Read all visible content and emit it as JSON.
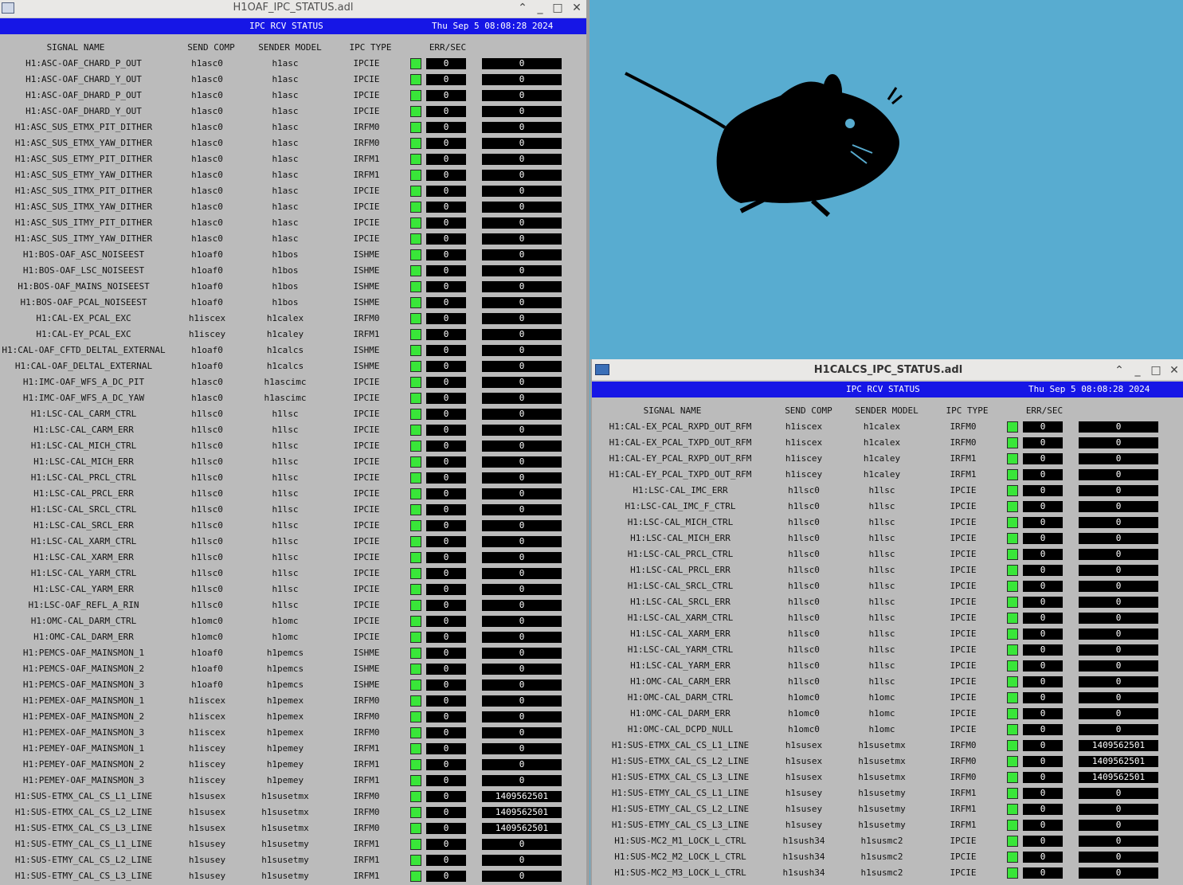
{
  "desktop": {
    "background_color": "#58acd0",
    "logo": "xfce-mouse-logo"
  },
  "windows": [
    {
      "id": "win1",
      "title": "H1OAF_IPC_STATUS.adl",
      "banner_title": "IPC RCV STATUS",
      "timestamp": "Thu Sep  5 08:08:28 2024",
      "headers": {
        "signal": "SIGNAL NAME",
        "comp": "SEND COMP",
        "model": "SENDER MODEL",
        "type": "IPC TYPE",
        "err": "ERR/SEC"
      },
      "rows": [
        [
          "H1:ASC-OAF_CHARD_P_OUT",
          "h1asc0",
          "h1asc",
          "IPCIE",
          "0",
          "0"
        ],
        [
          "H1:ASC-OAF_CHARD_Y_OUT",
          "h1asc0",
          "h1asc",
          "IPCIE",
          "0",
          "0"
        ],
        [
          "H1:ASC-OAF_DHARD_P_OUT",
          "h1asc0",
          "h1asc",
          "IPCIE",
          "0",
          "0"
        ],
        [
          "H1:ASC-OAF_DHARD_Y_OUT",
          "h1asc0",
          "h1asc",
          "IPCIE",
          "0",
          "0"
        ],
        [
          "H1:ASC_SUS_ETMX_PIT_DITHER",
          "h1asc0",
          "h1asc",
          "IRFM0",
          "0",
          "0"
        ],
        [
          "H1:ASC_SUS_ETMX_YAW_DITHER",
          "h1asc0",
          "h1asc",
          "IRFM0",
          "0",
          "0"
        ],
        [
          "H1:ASC_SUS_ETMY_PIT_DITHER",
          "h1asc0",
          "h1asc",
          "IRFM1",
          "0",
          "0"
        ],
        [
          "H1:ASC_SUS_ETMY_YAW_DITHER",
          "h1asc0",
          "h1asc",
          "IRFM1",
          "0",
          "0"
        ],
        [
          "H1:ASC_SUS_ITMX_PIT_DITHER",
          "h1asc0",
          "h1asc",
          "IPCIE",
          "0",
          "0"
        ],
        [
          "H1:ASC_SUS_ITMX_YAW_DITHER",
          "h1asc0",
          "h1asc",
          "IPCIE",
          "0",
          "0"
        ],
        [
          "H1:ASC_SUS_ITMY_PIT_DITHER",
          "h1asc0",
          "h1asc",
          "IPCIE",
          "0",
          "0"
        ],
        [
          "H1:ASC_SUS_ITMY_YAW_DITHER",
          "h1asc0",
          "h1asc",
          "IPCIE",
          "0",
          "0"
        ],
        [
          "H1:BOS-OAF_ASC_NOISEEST",
          "h1oaf0",
          "h1bos",
          "ISHME",
          "0",
          "0"
        ],
        [
          "H1:BOS-OAF_LSC_NOISEEST",
          "h1oaf0",
          "h1bos",
          "ISHME",
          "0",
          "0"
        ],
        [
          "H1:BOS-OAF_MAINS_NOISEEST",
          "h1oaf0",
          "h1bos",
          "ISHME",
          "0",
          "0"
        ],
        [
          "H1:BOS-OAF_PCAL_NOISEEST",
          "h1oaf0",
          "h1bos",
          "ISHME",
          "0",
          "0"
        ],
        [
          "H1:CAL-EX_PCAL_EXC",
          "h1iscex",
          "h1calex",
          "IRFM0",
          "0",
          "0"
        ],
        [
          "H1:CAL-EY_PCAL_EXC",
          "h1iscey",
          "h1caley",
          "IRFM1",
          "0",
          "0"
        ],
        [
          "H1:CAL-OAF_CFTD_DELTAL_EXTERNAL",
          "h1oaf0",
          "h1calcs",
          "ISHME",
          "0",
          "0"
        ],
        [
          "H1:CAL-OAF_DELTAL_EXTERNAL",
          "h1oaf0",
          "h1calcs",
          "ISHME",
          "0",
          "0"
        ],
        [
          "H1:IMC-OAF_WFS_A_DC_PIT",
          "h1asc0",
          "h1ascimc",
          "IPCIE",
          "0",
          "0"
        ],
        [
          "H1:IMC-OAF_WFS_A_DC_YAW",
          "h1asc0",
          "h1ascimc",
          "IPCIE",
          "0",
          "0"
        ],
        [
          "H1:LSC-CAL_CARM_CTRL",
          "h1lsc0",
          "h1lsc",
          "IPCIE",
          "0",
          "0"
        ],
        [
          "H1:LSC-CAL_CARM_ERR",
          "h1lsc0",
          "h1lsc",
          "IPCIE",
          "0",
          "0"
        ],
        [
          "H1:LSC-CAL_MICH_CTRL",
          "h1lsc0",
          "h1lsc",
          "IPCIE",
          "0",
          "0"
        ],
        [
          "H1:LSC-CAL_MICH_ERR",
          "h1lsc0",
          "h1lsc",
          "IPCIE",
          "0",
          "0"
        ],
        [
          "H1:LSC-CAL_PRCL_CTRL",
          "h1lsc0",
          "h1lsc",
          "IPCIE",
          "0",
          "0"
        ],
        [
          "H1:LSC-CAL_PRCL_ERR",
          "h1lsc0",
          "h1lsc",
          "IPCIE",
          "0",
          "0"
        ],
        [
          "H1:LSC-CAL_SRCL_CTRL",
          "h1lsc0",
          "h1lsc",
          "IPCIE",
          "0",
          "0"
        ],
        [
          "H1:LSC-CAL_SRCL_ERR",
          "h1lsc0",
          "h1lsc",
          "IPCIE",
          "0",
          "0"
        ],
        [
          "H1:LSC-CAL_XARM_CTRL",
          "h1lsc0",
          "h1lsc",
          "IPCIE",
          "0",
          "0"
        ],
        [
          "H1:LSC-CAL_XARM_ERR",
          "h1lsc0",
          "h1lsc",
          "IPCIE",
          "0",
          "0"
        ],
        [
          "H1:LSC-CAL_YARM_CTRL",
          "h1lsc0",
          "h1lsc",
          "IPCIE",
          "0",
          "0"
        ],
        [
          "H1:LSC-CAL_YARM_ERR",
          "h1lsc0",
          "h1lsc",
          "IPCIE",
          "0",
          "0"
        ],
        [
          "H1:LSC-OAF_REFL_A_RIN",
          "h1lsc0",
          "h1lsc",
          "IPCIE",
          "0",
          "0"
        ],
        [
          "H1:OMC-CAL_DARM_CTRL",
          "h1omc0",
          "h1omc",
          "IPCIE",
          "0",
          "0"
        ],
        [
          "H1:OMC-CAL_DARM_ERR",
          "h1omc0",
          "h1omc",
          "IPCIE",
          "0",
          "0"
        ],
        [
          "H1:PEMCS-OAF_MAINSMON_1",
          "h1oaf0",
          "h1pemcs",
          "ISHME",
          "0",
          "0"
        ],
        [
          "H1:PEMCS-OAF_MAINSMON_2",
          "h1oaf0",
          "h1pemcs",
          "ISHME",
          "0",
          "0"
        ],
        [
          "H1:PEMCS-OAF_MAINSMON_3",
          "h1oaf0",
          "h1pemcs",
          "ISHME",
          "0",
          "0"
        ],
        [
          "H1:PEMEX-OAF_MAINSMON_1",
          "h1iscex",
          "h1pemex",
          "IRFM0",
          "0",
          "0"
        ],
        [
          "H1:PEMEX-OAF_MAINSMON_2",
          "h1iscex",
          "h1pemex",
          "IRFM0",
          "0",
          "0"
        ],
        [
          "H1:PEMEX-OAF_MAINSMON_3",
          "h1iscex",
          "h1pemex",
          "IRFM0",
          "0",
          "0"
        ],
        [
          "H1:PEMEY-OAF_MAINSMON_1",
          "h1iscey",
          "h1pemey",
          "IRFM1",
          "0",
          "0"
        ],
        [
          "H1:PEMEY-OAF_MAINSMON_2",
          "h1iscey",
          "h1pemey",
          "IRFM1",
          "0",
          "0"
        ],
        [
          "H1:PEMEY-OAF_MAINSMON_3",
          "h1iscey",
          "h1pemey",
          "IRFM1",
          "0",
          "0"
        ],
        [
          "H1:SUS-ETMX_CAL_CS_L1_LINE",
          "h1susex",
          "h1susetmx",
          "IRFM0",
          "0",
          "1409562501"
        ],
        [
          "H1:SUS-ETMX_CAL_CS_L2_LINE",
          "h1susex",
          "h1susetmx",
          "IRFM0",
          "0",
          "1409562501"
        ],
        [
          "H1:SUS-ETMX_CAL_CS_L3_LINE",
          "h1susex",
          "h1susetmx",
          "IRFM0",
          "0",
          "1409562501"
        ],
        [
          "H1:SUS-ETMY_CAL_CS_L1_LINE",
          "h1susey",
          "h1susetmy",
          "IRFM1",
          "0",
          "0"
        ],
        [
          "H1:SUS-ETMY_CAL_CS_L2_LINE",
          "h1susey",
          "h1susetmy",
          "IRFM1",
          "0",
          "0"
        ],
        [
          "H1:SUS-ETMY_CAL_CS_L3_LINE",
          "h1susey",
          "h1susetmy",
          "IRFM1",
          "0",
          "0"
        ]
      ]
    },
    {
      "id": "win2",
      "title": "H1CALCS_IPC_STATUS.adl",
      "banner_title": "IPC RCV STATUS",
      "timestamp": "Thu Sep  5 08:08:28 2024",
      "headers": {
        "signal": "SIGNAL NAME",
        "comp": "SEND COMP",
        "model": "SENDER MODEL",
        "type": "IPC TYPE",
        "err": "ERR/SEC"
      },
      "rows": [
        [
          "H1:CAL-EX_PCAL_RXPD_OUT_RFM",
          "h1iscex",
          "h1calex",
          "IRFM0",
          "0",
          "0"
        ],
        [
          "H1:CAL-EX_PCAL_TXPD_OUT_RFM",
          "h1iscex",
          "h1calex",
          "IRFM0",
          "0",
          "0"
        ],
        [
          "H1:CAL-EY_PCAL_RXPD_OUT_RFM",
          "h1iscey",
          "h1caley",
          "IRFM1",
          "0",
          "0"
        ],
        [
          "H1:CAL-EY_PCAL_TXPD_OUT_RFM",
          "h1iscey",
          "h1caley",
          "IRFM1",
          "0",
          "0"
        ],
        [
          "H1:LSC-CAL_IMC_ERR",
          "h1lsc0",
          "h1lsc",
          "IPCIE",
          "0",
          "0"
        ],
        [
          "H1:LSC-CAL_IMC_F_CTRL",
          "h1lsc0",
          "h1lsc",
          "IPCIE",
          "0",
          "0"
        ],
        [
          "H1:LSC-CAL_MICH_CTRL",
          "h1lsc0",
          "h1lsc",
          "IPCIE",
          "0",
          "0"
        ],
        [
          "H1:LSC-CAL_MICH_ERR",
          "h1lsc0",
          "h1lsc",
          "IPCIE",
          "0",
          "0"
        ],
        [
          "H1:LSC-CAL_PRCL_CTRL",
          "h1lsc0",
          "h1lsc",
          "IPCIE",
          "0",
          "0"
        ],
        [
          "H1:LSC-CAL_PRCL_ERR",
          "h1lsc0",
          "h1lsc",
          "IPCIE",
          "0",
          "0"
        ],
        [
          "H1:LSC-CAL_SRCL_CTRL",
          "h1lsc0",
          "h1lsc",
          "IPCIE",
          "0",
          "0"
        ],
        [
          "H1:LSC-CAL_SRCL_ERR",
          "h1lsc0",
          "h1lsc",
          "IPCIE",
          "0",
          "0"
        ],
        [
          "H1:LSC-CAL_XARM_CTRL",
          "h1lsc0",
          "h1lsc",
          "IPCIE",
          "0",
          "0"
        ],
        [
          "H1:LSC-CAL_XARM_ERR",
          "h1lsc0",
          "h1lsc",
          "IPCIE",
          "0",
          "0"
        ],
        [
          "H1:LSC-CAL_YARM_CTRL",
          "h1lsc0",
          "h1lsc",
          "IPCIE",
          "0",
          "0"
        ],
        [
          "H1:LSC-CAL_YARM_ERR",
          "h1lsc0",
          "h1lsc",
          "IPCIE",
          "0",
          "0"
        ],
        [
          "H1:OMC-CAL_CARM_ERR",
          "h1lsc0",
          "h1lsc",
          "IPCIE",
          "0",
          "0"
        ],
        [
          "H1:OMC-CAL_DARM_CTRL",
          "h1omc0",
          "h1omc",
          "IPCIE",
          "0",
          "0"
        ],
        [
          "H1:OMC-CAL_DARM_ERR",
          "h1omc0",
          "h1omc",
          "IPCIE",
          "0",
          "0"
        ],
        [
          "H1:OMC-CAL_DCPD_NULL",
          "h1omc0",
          "h1omc",
          "IPCIE",
          "0",
          "0"
        ],
        [
          "H1:SUS-ETMX_CAL_CS_L1_LINE",
          "h1susex",
          "h1susetmx",
          "IRFM0",
          "0",
          "1409562501"
        ],
        [
          "H1:SUS-ETMX_CAL_CS_L2_LINE",
          "h1susex",
          "h1susetmx",
          "IRFM0",
          "0",
          "1409562501"
        ],
        [
          "H1:SUS-ETMX_CAL_CS_L3_LINE",
          "h1susex",
          "h1susetmx",
          "IRFM0",
          "0",
          "1409562501"
        ],
        [
          "H1:SUS-ETMY_CAL_CS_L1_LINE",
          "h1susey",
          "h1susetmy",
          "IRFM1",
          "0",
          "0"
        ],
        [
          "H1:SUS-ETMY_CAL_CS_L2_LINE",
          "h1susey",
          "h1susetmy",
          "IRFM1",
          "0",
          "0"
        ],
        [
          "H1:SUS-ETMY_CAL_CS_L3_LINE",
          "h1susey",
          "h1susetmy",
          "IRFM1",
          "0",
          "0"
        ],
        [
          "H1:SUS-MC2_M1_LOCK_L_CTRL",
          "h1sush34",
          "h1susmc2",
          "IPCIE",
          "0",
          "0"
        ],
        [
          "H1:SUS-MC2_M2_LOCK_L_CTRL",
          "h1sush34",
          "h1susmc2",
          "IPCIE",
          "0",
          "0"
        ],
        [
          "H1:SUS-MC2_M3_LOCK_L_CTRL",
          "h1sush34",
          "h1susmc2",
          "IPCIE",
          "0",
          "0"
        ]
      ]
    }
  ],
  "colors": {
    "banner": "#1616e6",
    "panel": "#bbbbbb",
    "led_ok": "#39e639"
  }
}
